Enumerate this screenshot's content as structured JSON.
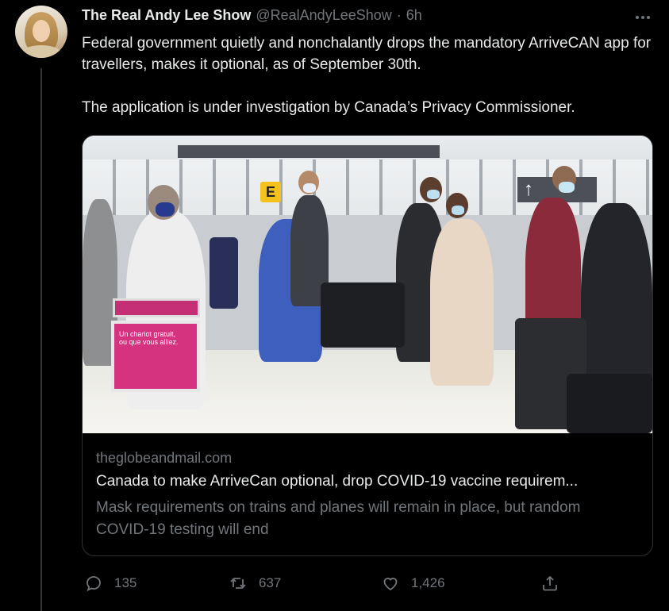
{
  "tweet": {
    "author_name": "The Real Andy Lee Show",
    "handle": "@RealAndyLeeShow",
    "separator": "·",
    "time": "6h",
    "text_line1": "Federal government quietly and nonchalantly drops the mandatory ArriveCAN app for travellers, makes it optional, as of September 30th.",
    "text_line2": "The application is under investigation by Canada’s Privacy Commissioner."
  },
  "card": {
    "image_sign_letter": "E",
    "image_cart_text": "Un chariot gratuit, ou que vous alliez.",
    "domain": "theglobeandmail.com",
    "title": "Canada to make ArriveCan optional, drop COVID-19 vaccine requirem...",
    "description": "Mask requirements on trains and planes will remain in place, but random COVID-19 testing will end"
  },
  "actions": {
    "replies": "135",
    "retweets": "637",
    "likes": "1,426"
  },
  "icons": {
    "more": "more-horizontal-icon",
    "reply": "reply-bubble-icon",
    "retweet": "retweet-arrows-icon",
    "like": "heart-icon",
    "share": "share-upload-icon"
  },
  "colors": {
    "background": "#000000",
    "primary_text": "#e7e9ea",
    "secondary_text": "#71767b",
    "border": "#2f3336"
  }
}
